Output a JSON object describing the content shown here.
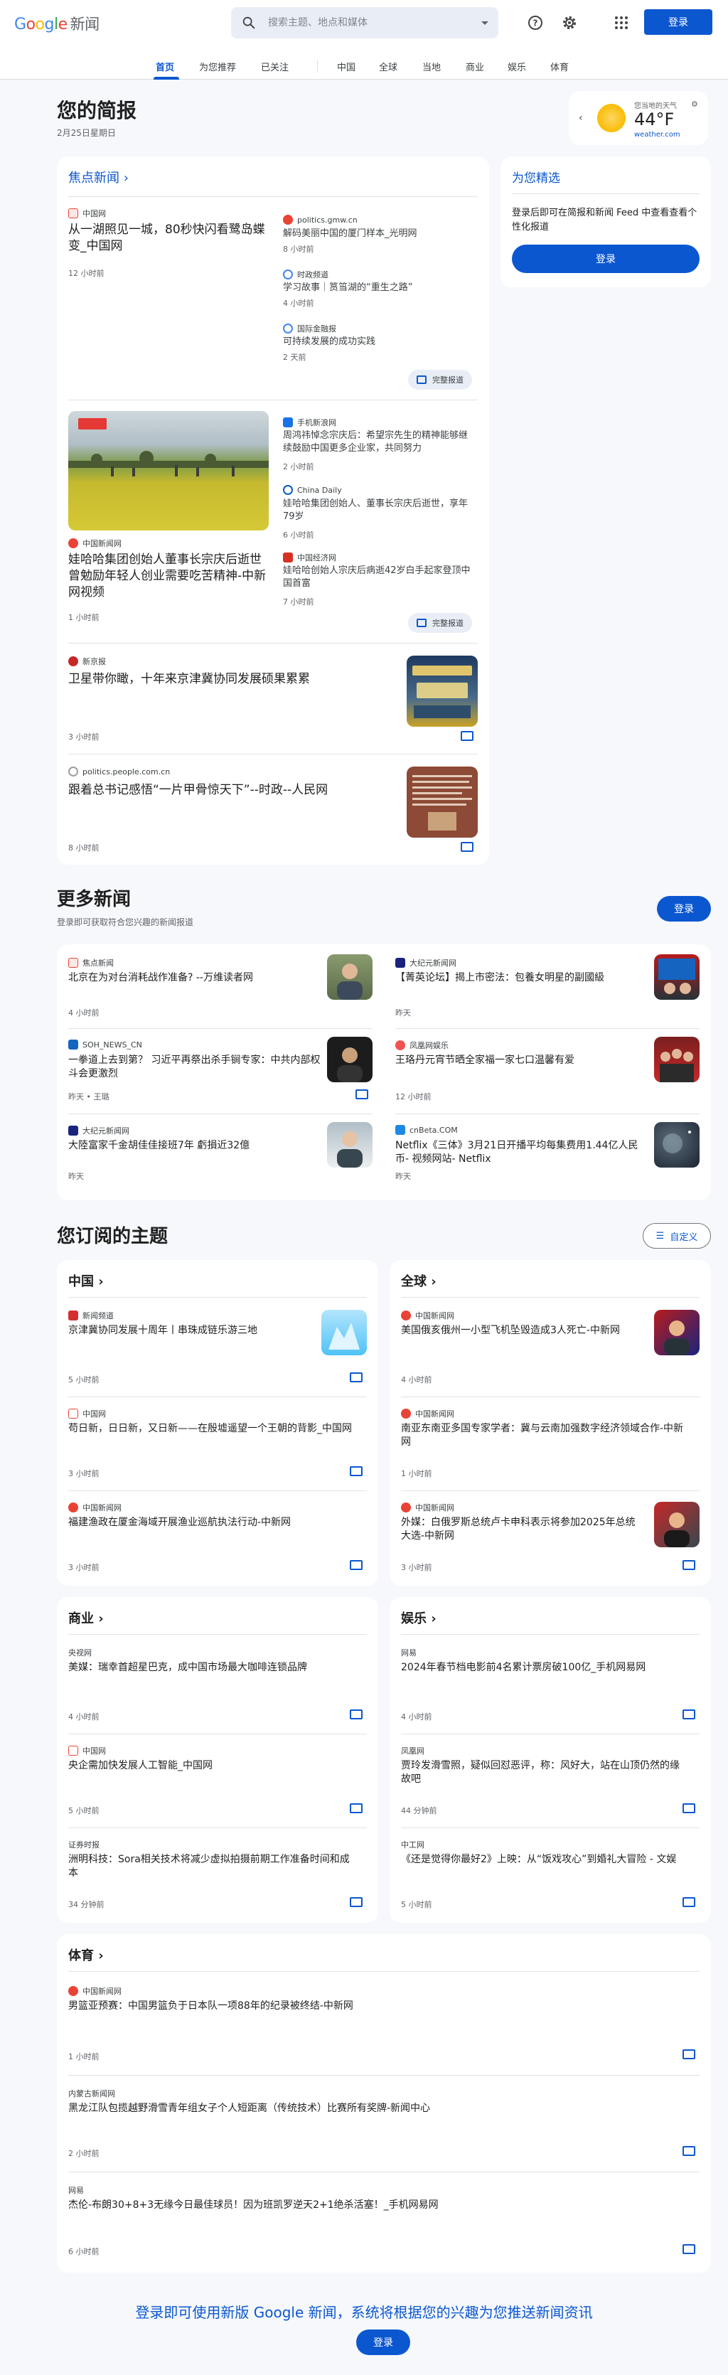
{
  "header": {
    "logo_google": [
      "G",
      "o",
      "o",
      "g",
      "l",
      "e"
    ],
    "logo_news": "新闻",
    "search_placeholder": "搜索主题、地点和媒体",
    "login_label": "登录"
  },
  "nav": {
    "items": [
      "首页",
      "为您推荐",
      "已关注",
      "中国",
      "全球",
      "当地",
      "商业",
      "娱乐",
      "体育"
    ]
  },
  "briefing": {
    "title": "您的简报",
    "date": "2月25日星期日"
  },
  "weather": {
    "location_label": "您当地的天气",
    "temp": "44°F",
    "source": "weather.com"
  },
  "top_stories": {
    "section_label": "焦点新闻",
    "full_coverage_label": "完整报道",
    "clusters": [
      {
        "main": {
          "source": "中国网",
          "title": "从一湖照见一城，80秒快闪看鹭岛蝶变_中国网",
          "time": "12 小时前"
        },
        "related": [
          {
            "source": "politics.gmw.cn",
            "title": "解码美丽中国的厦门样本_光明网",
            "time": "8 小时前"
          },
          {
            "source": "时政频道",
            "title": "学习故事｜筼筜湖的“重生之路”",
            "time": "4 小时前"
          },
          {
            "source": "国际金融报",
            "title": "可持续发展的成功实践",
            "time": "2 天前"
          }
        ]
      },
      {
        "main": {
          "source": "中国新闻网",
          "title": "娃哈哈集团创始人董事长宗庆后逝世曾勉励年轻人创业需要吃苦精神-中新网视频",
          "time": "1 小时前"
        },
        "related": [
          {
            "source": "手机新浪网",
            "title": "周鸿祎悼念宗庆后：希望宗先生的精神能够继续鼓励中国更多企业家，共同努力",
            "time": "2 小时前"
          },
          {
            "source": "China Daily",
            "title": "娃哈哈集团创始人、董事长宗庆后逝世，享年79岁",
            "time": "6 小时前"
          },
          {
            "source": "中国经济网",
            "title": "娃哈哈创始人宗庆后病逝42岁白手起家登顶中国首富",
            "time": "7 小时前"
          }
        ]
      },
      {
        "source": "新京报",
        "title": "卫星带你瞰，十年来京津冀协同发展硕果累累",
        "time": "3 小时前"
      },
      {
        "source": "politics.people.com.cn",
        "title": "跟着总书记感悟“一片甲骨惊天下”--时政--人民网",
        "time": "8 小时前"
      }
    ]
  },
  "for_you": {
    "title": "为您精选",
    "body": "登录后即可在简报和新闻 Feed 中查看查看个性化报道",
    "login_label": "登录"
  },
  "more_news": {
    "title": "更多新闻",
    "subtitle": "登录即可获取符合您兴趣的新闻报道",
    "login_label": "登录",
    "items": [
      {
        "source": "焦点新闻",
        "title": "北京在为对台消耗战作准备? --万维读者网",
        "time": "4 小时前"
      },
      {
        "source": "大纪元新闻网",
        "title": "【菁英论坛】揭上市密法：包養女明星的副國級",
        "time": "昨天"
      },
      {
        "source": "SOH_NEWS_CN",
        "title": "一拳道上去到第？ 习近平再祭出杀手锏专家：中共内部权斗会更激烈",
        "time": "昨天 • 王璐"
      },
      {
        "source": "凤凰网娱乐",
        "title": "王珞丹元宵节晒全家福一家七口温馨有爱",
        "time": "12 小时前"
      },
      {
        "source": "大纪元新闻网",
        "title": "大陸富家千金胡佳佳接班7年 虧損近32億",
        "time": "昨天"
      },
      {
        "source": "cnBeta.COM",
        "title": "Netflix《三体》3月21日开播平均每集费用1.44亿人民币- 视频网站- Netflix",
        "time": "昨天"
      }
    ]
  },
  "topics": {
    "title": "您订阅的主题",
    "customize_label": "自定义",
    "china": {
      "label": "中国",
      "items": [
        {
          "source": "新闻频道",
          "title": "京津冀协同发展十周年丨串珠成链乐游三地",
          "time": "5 小时前"
        },
        {
          "source": "中国网",
          "title": "苟日新，日日新，又日新——在殷墟遥望一个王朝的背影_中国网",
          "time": "3 小时前"
        },
        {
          "source": "中国新闻网",
          "title": "福建渔政在厦金海域开展渔业巡航执法行动-中新网",
          "time": "3 小时前"
        }
      ]
    },
    "world": {
      "label": "全球",
      "items": [
        {
          "source": "中国新闻网",
          "title": "美国俄亥俄州一小型飞机坠毁造成3人死亡-中新网",
          "time": "4 小时前"
        },
        {
          "source": "中国新闻网",
          "title": "南亚东南亚多国专家学者：冀与云南加强数字经济领域合作-中新网",
          "time": "1 小时前"
        },
        {
          "source": "中国新闻网",
          "title": "外媒：白俄罗斯总统卢卡申科表示将参加2025年总统大选-中新网",
          "time": "3 小时前"
        }
      ]
    },
    "business": {
      "label": "商业",
      "items": [
        {
          "source": "央视网",
          "title": "美媒：瑞幸首超星巴克，成中国市场最大咖啡连锁品牌",
          "time": "4 小时前"
        },
        {
          "source": "中国网",
          "title": "央企需加快发展人工智能_中国网",
          "time": "5 小时前"
        },
        {
          "source": "证券时报",
          "title": "洲明科技：Sora相关技术将减少虚拟拍摄前期工作准备时间和成本",
          "time": "34 分钟前"
        }
      ]
    },
    "entertainment": {
      "label": "娱乐",
      "items": [
        {
          "source": "网易",
          "title": "2024年春节档电影前4名累计票房破100亿_手机网易网",
          "time": "4 小时前"
        },
        {
          "source": "凤凰网",
          "title": "贾玲发滑雪照，疑似回怼恶评，称：风好大，站在山顶仍然的缘故吧",
          "time": "44 分钟前"
        },
        {
          "source": "中工网",
          "title": "《还是觉得你最好2》上映：从“饭戏攻心”到婚礼大冒险 - 文娱",
          "time": "5 小时前"
        }
      ]
    },
    "sports": {
      "label": "体育",
      "items": [
        {
          "source": "中国新闻网",
          "title": "男篮亚预赛：中国男篮负于日本队一项88年的纪录被终结-中新网",
          "time": "1 小时前"
        },
        {
          "source": "内蒙古新闻网",
          "title": "黑龙江队包揽越野滑雪青年组女子个人短距离（传统技术）比赛所有奖牌-新闻中心",
          "time": "2 小时前"
        },
        {
          "source": "网易",
          "title": "杰伦-布朗30+8+3无缘今日最佳球员！因为班凯罗逆天2+1绝杀活塞！_手机网易网",
          "time": "6 小时前"
        }
      ]
    }
  },
  "footer": {
    "cta": "登录即可使用新版 Google 新闻，系统将根据您的兴趣为您推送新闻资讯",
    "login_label": "登录"
  },
  "colors": {
    "accent": "#0b57d0",
    "background": "#f6f8fc",
    "card": "#ffffff"
  }
}
